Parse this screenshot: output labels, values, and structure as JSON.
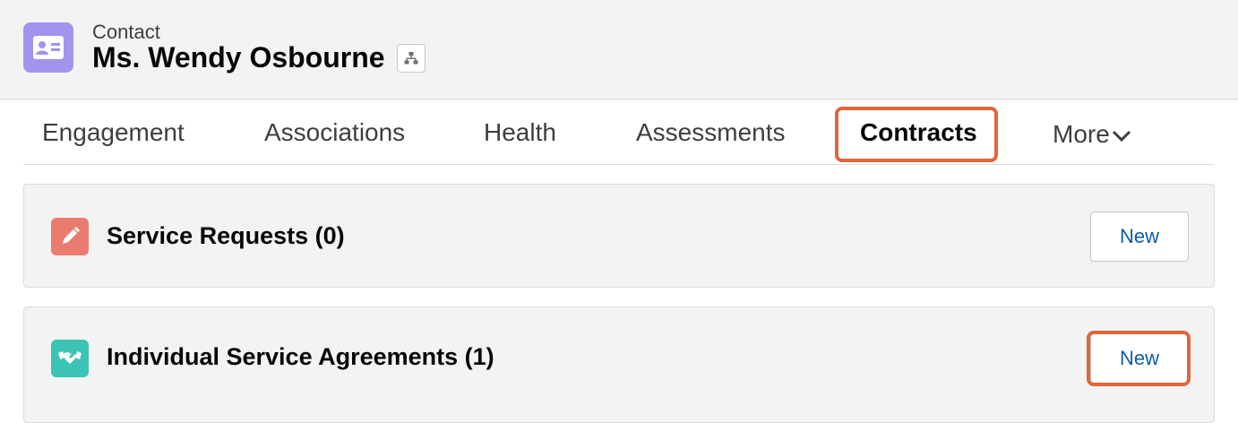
{
  "header": {
    "object_label": "Contact",
    "record_name": "Ms. Wendy Osbourne",
    "record_icon": "contact-card-icon",
    "hierarchy_icon": "hierarchy-icon"
  },
  "tabs": [
    {
      "label": "Engagement",
      "active": false
    },
    {
      "label": "Associations",
      "active": false
    },
    {
      "label": "Health",
      "active": false
    },
    {
      "label": "Assessments",
      "active": false
    },
    {
      "label": "Contracts",
      "active": true
    },
    {
      "label": "More",
      "active": false
    }
  ],
  "cards": [
    {
      "title": "Service Requests (0)",
      "icon": "pencil-icon",
      "icon_color": "#ea7c6f",
      "button_label": "New"
    },
    {
      "title": "Individual Service Agreements (1)",
      "icon": "handshake-icon",
      "icon_color": "#3bc4b3",
      "button_label": "New"
    }
  ],
  "colors": {
    "highlight": "#e0663d",
    "contact_icon": "#a094ed",
    "link_blue": "#0b5cab"
  }
}
